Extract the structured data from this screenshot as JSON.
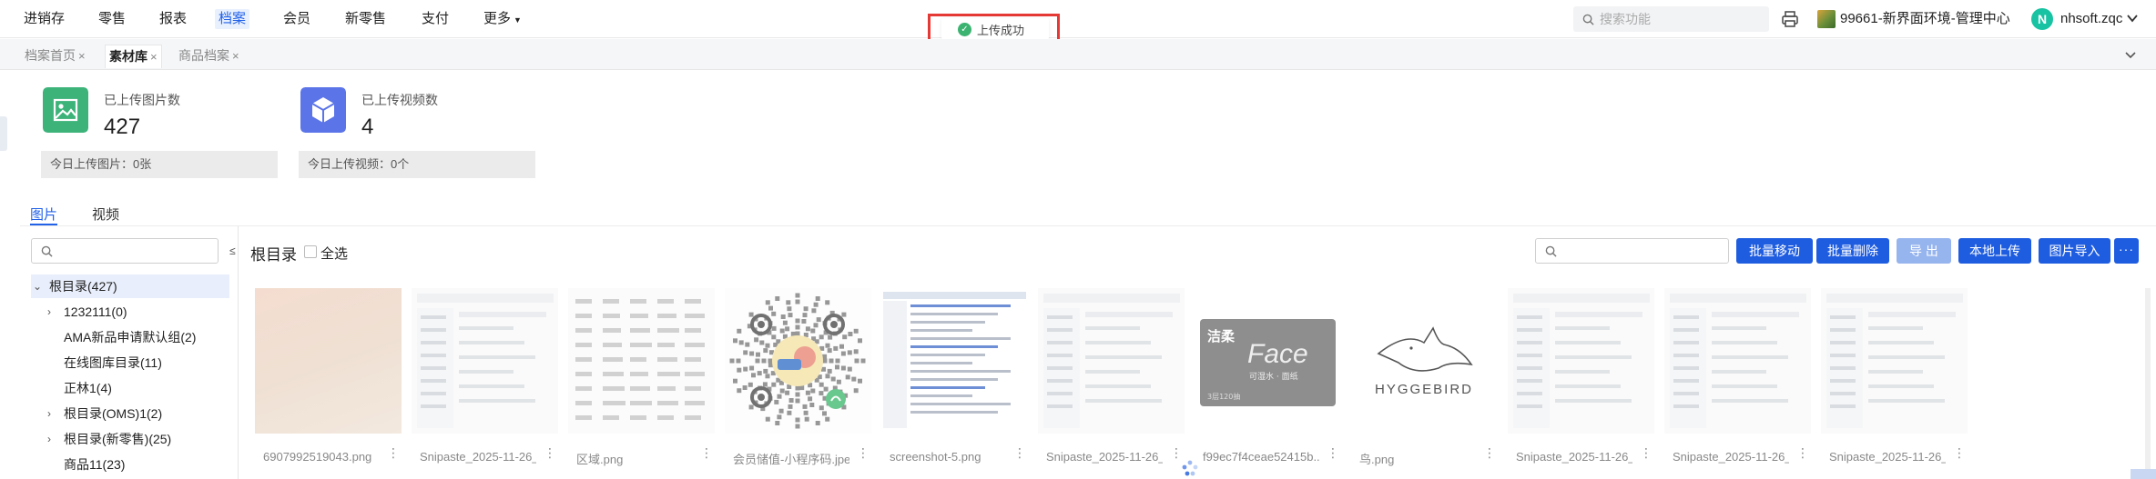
{
  "nav": {
    "items": [
      "进销存",
      "零售",
      "报表",
      "档案",
      "会员",
      "新零售",
      "支付"
    ],
    "more_label": "更多",
    "active": "档案",
    "search_placeholder": "搜索功能",
    "store": "99661-新界面环境-管理中心",
    "avatar_letter": "N",
    "user": "nhsoft.zqc"
  },
  "toast": {
    "message": "上传成功",
    "color_outline": "#e53935"
  },
  "tabs": [
    {
      "label": "档案首页",
      "close": "×"
    },
    {
      "label": "素材库",
      "close": "×",
      "active": true
    },
    {
      "label": "商品档案",
      "close": "×"
    }
  ],
  "stats": {
    "images": {
      "label": "已上传图片数",
      "value": "427",
      "foot": "今日上传图片：0张",
      "color": "#3db37a"
    },
    "videos": {
      "label": "已上传视频数",
      "value": "4",
      "foot": "今日上传视频：0个",
      "color": "#5b74e8"
    }
  },
  "media_tabs": {
    "images": "图片",
    "videos": "视频"
  },
  "tree": {
    "collapse_glyph": "≤",
    "items": [
      {
        "label": "根目录(427)",
        "arrow": "⌄",
        "root": true
      },
      {
        "label": "1232111(0)",
        "arrow": "›"
      },
      {
        "label": "AMA新品申请默认组(2)",
        "arrow": ""
      },
      {
        "label": "在线图库目录(11)",
        "arrow": ""
      },
      {
        "label": "正林1(4)",
        "arrow": ""
      },
      {
        "label": "根目录(OMS)1(2)",
        "arrow": "›"
      },
      {
        "label": "根目录(新零售)(25)",
        "arrow": "›"
      },
      {
        "label": "商品11(23)",
        "arrow": ""
      }
    ]
  },
  "content": {
    "title": "根目录",
    "select_all": "全选",
    "buttons": [
      "批量移动",
      "批量删除",
      "导 出",
      "本地上传",
      "图片导入"
    ],
    "more": "···",
    "accent": "#1f5de0"
  },
  "images": [
    {
      "name": "6907992519043.png",
      "kind": "beige"
    },
    {
      "name": "Snipaste_2025-11-26_...",
      "kind": "screenshot"
    },
    {
      "name": "区域.png",
      "kind": "text"
    },
    {
      "name": "会员储值-小程序码.jpeg",
      "kind": "qr"
    },
    {
      "name": "screenshot-5.png",
      "kind": "app"
    },
    {
      "name": "Snipaste_2025-11-26_...",
      "kind": "screenshot"
    },
    {
      "name": "f99ec7f4ceae52415b...",
      "kind": "face"
    },
    {
      "name": "鸟.png",
      "kind": "bird"
    },
    {
      "name": "Snipaste_2025-11-26_...",
      "kind": "screenshot"
    },
    {
      "name": "Snipaste_2025-11-26_...",
      "kind": "screenshot"
    },
    {
      "name": "Snipaste_2025-11-26_...",
      "kind": "screenshot"
    }
  ],
  "thumb_text": {
    "face_brand": "洁柔",
    "face_word": "Face",
    "face_sub": "可湿水 · 面纸",
    "face_count": "3层120抽",
    "bird_word": "HYGGEBIRD"
  }
}
